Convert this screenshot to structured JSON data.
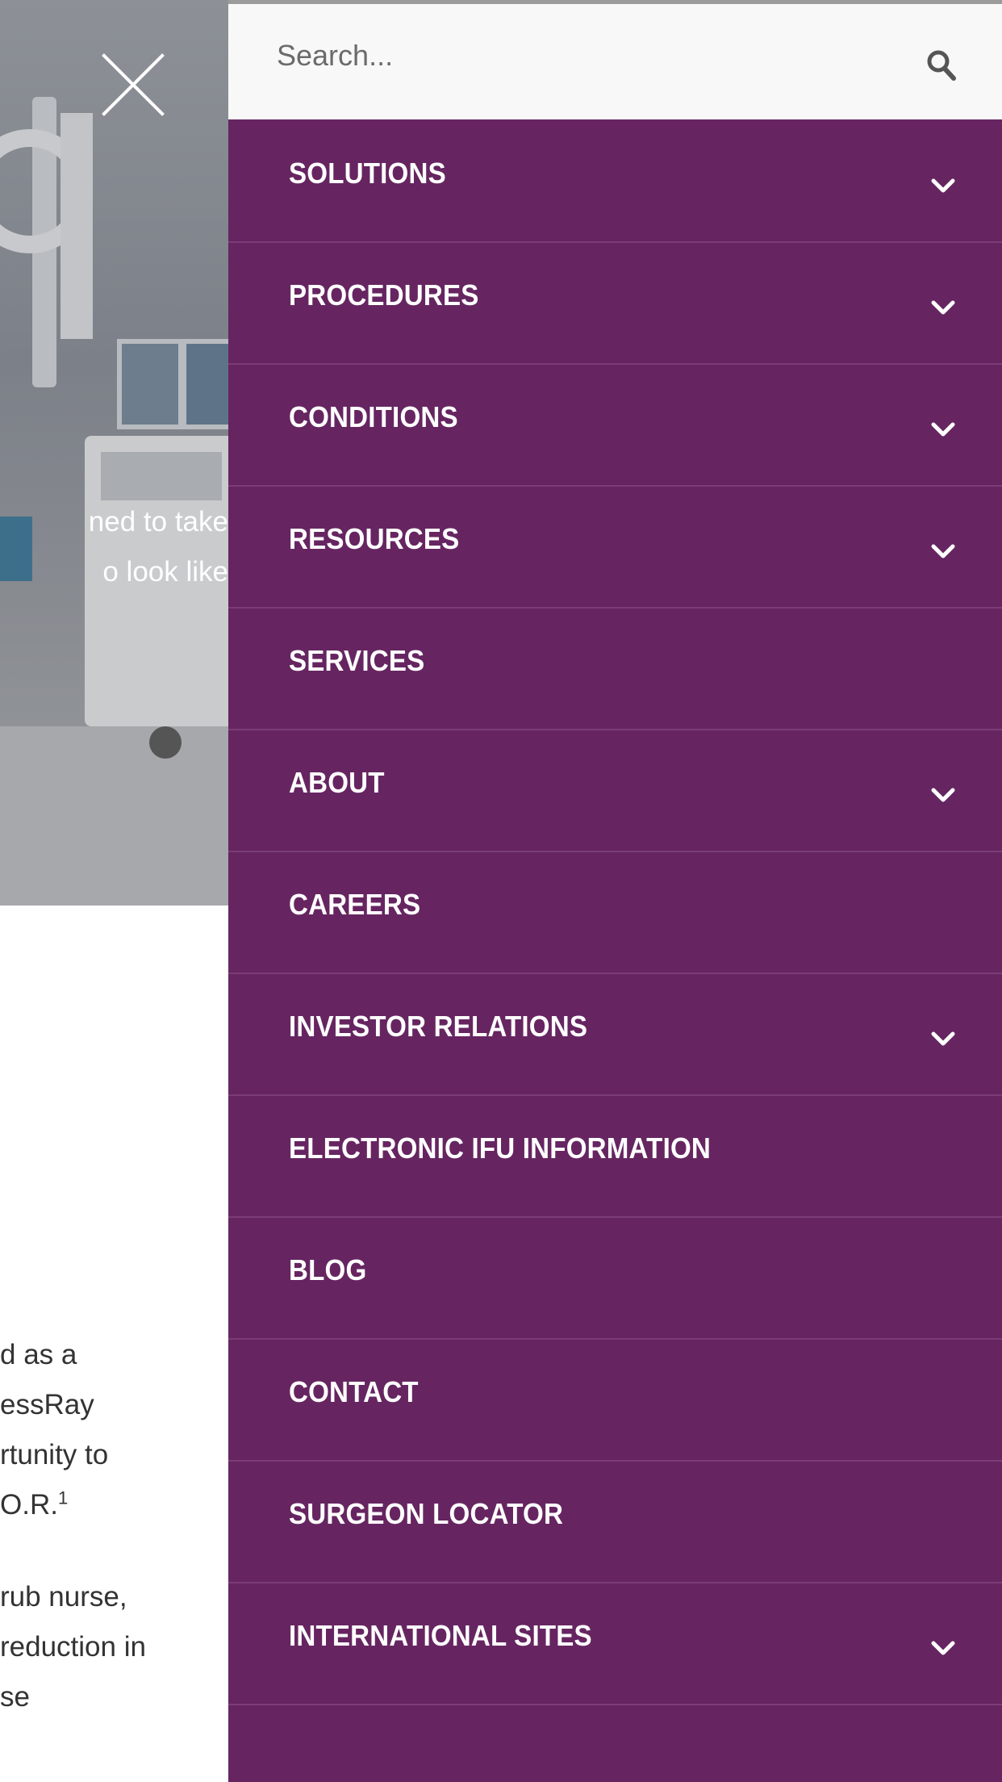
{
  "background_page": {
    "hero_text_lines": [
      "ned to take",
      "o look like"
    ],
    "article_lines": [
      "d as a",
      "essRay",
      "rtunity to",
      " O.R.",
      "rub nurse,",
      "reduction in",
      "se"
    ],
    "footnote_marker": "1"
  },
  "search": {
    "placeholder": "Search..."
  },
  "menu": {
    "items": [
      {
        "label": "SOLUTIONS",
        "expandable": true
      },
      {
        "label": "PROCEDURES",
        "expandable": true
      },
      {
        "label": "CONDITIONS",
        "expandable": true
      },
      {
        "label": "RESOURCES",
        "expandable": true
      },
      {
        "label": "SERVICES",
        "expandable": false
      },
      {
        "label": "ABOUT",
        "expandable": true
      },
      {
        "label": "CAREERS",
        "expandable": false
      },
      {
        "label": "INVESTOR RELATIONS",
        "expandable": true
      },
      {
        "label": "ELECTRONIC IFU INFORMATION",
        "expandable": false
      },
      {
        "label": "BLOG",
        "expandable": false
      },
      {
        "label": "CONTACT",
        "expandable": false
      },
      {
        "label": "SURGEON LOCATOR",
        "expandable": false
      },
      {
        "label": "INTERNATIONAL SITES",
        "expandable": true
      }
    ]
  },
  "colors": {
    "menu_background": "#662561",
    "menu_divider": "#7b3d76",
    "search_background": "#f8f8f8"
  },
  "icons": {
    "close": "close-icon",
    "search": "search-icon",
    "expand": "chevron-down-icon"
  }
}
